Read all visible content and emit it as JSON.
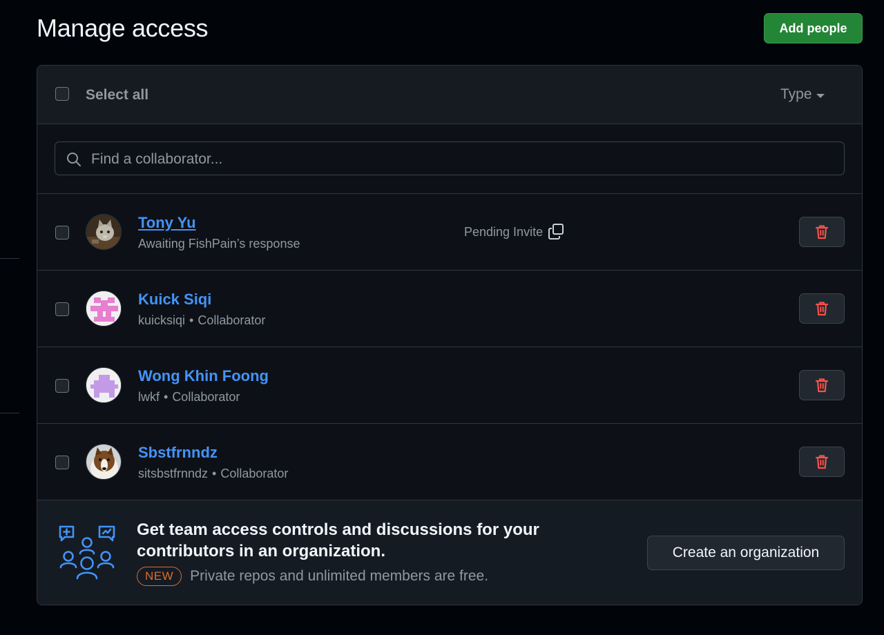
{
  "page": {
    "title": "Manage access",
    "add_people_label": "Add people"
  },
  "list_header": {
    "select_all_label": "Select all",
    "type_filter_label": "Type"
  },
  "search": {
    "placeholder": "Find a collaborator...",
    "value": ""
  },
  "collaborators": [
    {
      "name": "Tony Yu",
      "subtitle": "Awaiting FishPain’s response",
      "username": "",
      "role": "",
      "status": "Pending Invite",
      "avatar": "cat-photo"
    },
    {
      "name": "Kuick Siqi",
      "subtitle": "",
      "username": "kuicksiqi",
      "role": "Collaborator",
      "avatar": "pink-identicon"
    },
    {
      "name": "Wong Khin Foong",
      "subtitle": "",
      "username": "lwkf",
      "role": "Collaborator",
      "avatar": "purple-identicon"
    },
    {
      "name": "Sbstfrnndz",
      "subtitle": "",
      "username": "sitsbstfrnndz",
      "role": "Collaborator",
      "avatar": "dog-photo"
    }
  ],
  "separator": "•",
  "promo": {
    "title": "Get team access controls and discussions for your contributors in an organization.",
    "badge": "NEW",
    "text": "Private repos and unlimited members are free.",
    "button_label": "Create an organization"
  },
  "colors": {
    "background": "#010409",
    "accent_link": "#4493f8",
    "primary_button": "#238636",
    "danger": "#f85149",
    "new_badge": "#db6d28"
  },
  "icons": [
    "search-icon",
    "copy-icon",
    "trash-icon",
    "team-icon",
    "chevron-down-icon"
  ]
}
